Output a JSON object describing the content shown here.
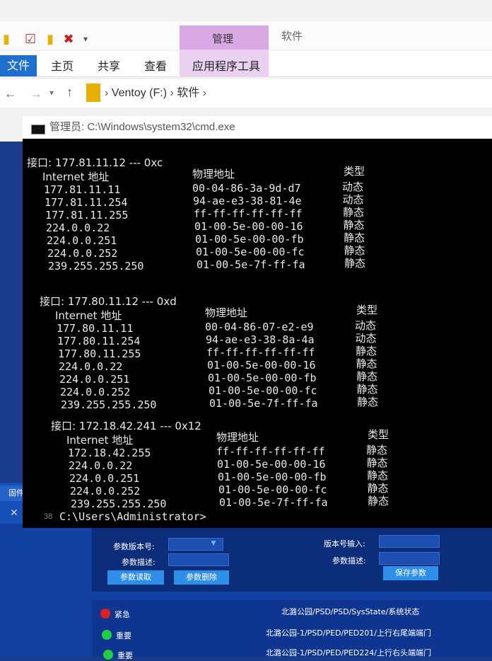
{
  "explorer": {
    "contextual_group": "管理",
    "contextual_group_right": "软件",
    "tabs": [
      "文件",
      "主页",
      "共享",
      "查看",
      "应用程序工具"
    ],
    "breadcrumb": [
      "Ventoy (F:)",
      "软件"
    ]
  },
  "cmd": {
    "title": "管理员: C:\\Windows\\system32\\cmd.exe",
    "col_internet": "Internet 地址",
    "col_physical": "物理地址",
    "col_type": "类型",
    "interfaces": [
      {
        "header": "接口: 177.81.11.12 --- 0xc",
        "rows": [
          [
            "177.81.11.11",
            "00-04-86-3a-9d-d7",
            "动态"
          ],
          [
            "177.81.11.254",
            "94-ae-e3-38-81-4e",
            "动态"
          ],
          [
            "177.81.11.255",
            "ff-ff-ff-ff-ff-ff",
            "静态"
          ],
          [
            "224.0.0.22",
            "01-00-5e-00-00-16",
            "静态"
          ],
          [
            "224.0.0.251",
            "01-00-5e-00-00-fb",
            "静态"
          ],
          [
            "224.0.0.252",
            "01-00-5e-00-00-fc",
            "静态"
          ],
          [
            "239.255.255.250",
            "01-00-5e-7f-ff-fa",
            "静态"
          ]
        ]
      },
      {
        "header": "接口: 177.80.11.12 --- 0xd",
        "rows": [
          [
            "177.80.11.11",
            "00-04-86-07-e2-e9",
            "动态"
          ],
          [
            "177.80.11.254",
            "94-ae-e3-38-8a-4a",
            "动态"
          ],
          [
            "177.80.11.255",
            "ff-ff-ff-ff-ff-ff",
            "静态"
          ],
          [
            "224.0.0.22",
            "01-00-5e-00-00-16",
            "静态"
          ],
          [
            "224.0.0.251",
            "01-00-5e-00-00-fb",
            "静态"
          ],
          [
            "224.0.0.252",
            "01-00-5e-00-00-fc",
            "静态"
          ],
          [
            "239.255.255.250",
            "01-00-5e-7f-ff-fa",
            "静态"
          ]
        ]
      },
      {
        "header": "接口: 172.18.42.241 --- 0x12",
        "rows": [
          [
            "172.18.42.255",
            "ff-ff-ff-ff-ff-ff",
            "静态"
          ],
          [
            "224.0.0.22",
            "01-00-5e-00-00-16",
            "静态"
          ],
          [
            "224.0.0.251",
            "01-00-5e-00-00-fb",
            "静态"
          ],
          [
            "224.0.0.252",
            "01-00-5e-00-00-fc",
            "静态"
          ],
          [
            "239.255.255.250",
            "01-00-5e-7f-ff-fa",
            "静态"
          ]
        ]
      }
    ],
    "prompt": "C:\\Users\\Administrator>",
    "prompt_gutter": "38"
  },
  "app": {
    "side_tab": "固件日",
    "param_version_label": "参数版本号:",
    "param_desc_label": "参数描述:",
    "version_input_label": "版本号输入:",
    "param_desc_label2": "参数描述:",
    "read_button": "参数读取",
    "delete_button": "参数删除",
    "save_button": "保存参数",
    "events": [
      {
        "level": "紧急",
        "color": "#e02020",
        "path": "北潞公园/PSD/PSD/SysState/系统状态"
      },
      {
        "level": "重要",
        "color": "#20d040",
        "path": "北潞公园-1/PSD/PED/PED201/上行右尾端端门"
      },
      {
        "level": "重要",
        "color": "#20d040",
        "path": "北潞公园-1/PSD/PED/PED224/上行右头端端门"
      }
    ]
  }
}
